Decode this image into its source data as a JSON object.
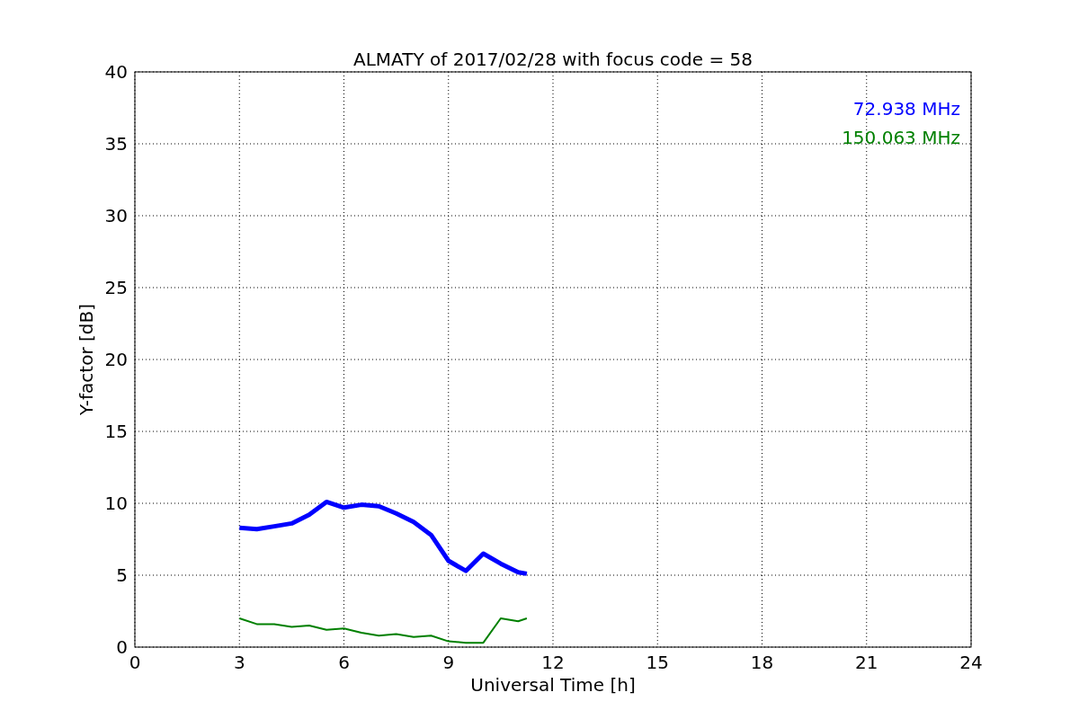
{
  "chart_data": {
    "type": "line",
    "title": "ALMATY of 2017/02/28 with focus code = 58",
    "xlabel": "Universal Time [h]",
    "ylabel": "Y-factor [dB]",
    "x": [
      3,
      3.5,
      4,
      4.5,
      5,
      5.5,
      6,
      6.5,
      7,
      7.5,
      8,
      8.5,
      9,
      9.5,
      10,
      10.5,
      11,
      11.25
    ],
    "series": [
      {
        "name": "72.938 MHz",
        "color": "#0000ff",
        "values": [
          8.3,
          8.2,
          8.4,
          8.6,
          9.2,
          10.1,
          9.7,
          9.9,
          9.8,
          9.3,
          8.7,
          7.8,
          6.0,
          5.3,
          6.5,
          5.8,
          5.2,
          5.1
        ]
      },
      {
        "name": "150.063 MHz",
        "color": "#008000",
        "values": [
          2.0,
          1.6,
          1.6,
          1.4,
          1.5,
          1.2,
          1.3,
          1.0,
          0.8,
          0.9,
          0.7,
          0.8,
          0.4,
          0.3,
          0.3,
          2.0,
          1.8,
          2.0
        ]
      }
    ],
    "xlim": [
      0,
      24
    ],
    "ylim": [
      0,
      40
    ],
    "xticks": [
      0,
      3,
      6,
      9,
      12,
      15,
      18,
      21,
      24
    ],
    "yticks": [
      0,
      5,
      10,
      15,
      20,
      25,
      30,
      35,
      40
    ],
    "grid": true
  }
}
